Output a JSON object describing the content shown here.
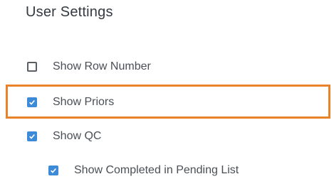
{
  "settings": {
    "title": "User Settings",
    "options": [
      {
        "label": "Show Row Number",
        "checked": false
      },
      {
        "label": "Show Priors",
        "checked": true
      },
      {
        "label": "Show QC",
        "checked": true
      },
      {
        "label": "Show Completed in Pending List",
        "checked": true
      }
    ]
  },
  "colors": {
    "accent": "#3c8ad8",
    "highlight": "#e8832a"
  }
}
